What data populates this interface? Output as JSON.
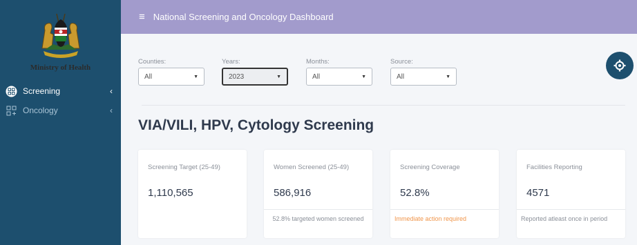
{
  "sidebar": {
    "ministry": "Ministry of Health",
    "items": [
      {
        "label": "Screening",
        "chevron": "‹",
        "icon": "grid-circle-icon"
      },
      {
        "label": "Oncology",
        "chevron": "‹",
        "icon": "grid-icon"
      }
    ]
  },
  "topbar": {
    "menu_icon": "≡",
    "title": "National Screening and Oncology Dashboard"
  },
  "filters": [
    {
      "label": "Counties:",
      "value": "All"
    },
    {
      "label": "Years:",
      "value": "2023"
    },
    {
      "label": "Months:",
      "value": "All"
    },
    {
      "label": "Source:",
      "value": "All"
    }
  ],
  "section_title": "VIA/VILI, HPV, Cytology Screening",
  "cards": [
    {
      "label": "Screening Target (25-49)",
      "value": "1,110,565",
      "footer": ""
    },
    {
      "label": "Women Screened (25-49)",
      "value": "586,916",
      "footer": "52.8% targeted women screened"
    },
    {
      "label": "Screening Coverage",
      "value": "52.8%",
      "footer": "Immediate action required"
    },
    {
      "label": "Facilities Reporting",
      "value": "4571",
      "footer": "Reported atleast once in period"
    }
  ],
  "colors": {
    "sidebar": "#1d4f6e",
    "topbar": "#a29bcc",
    "warning": "#f0954a",
    "background": "#f4f6f9"
  }
}
